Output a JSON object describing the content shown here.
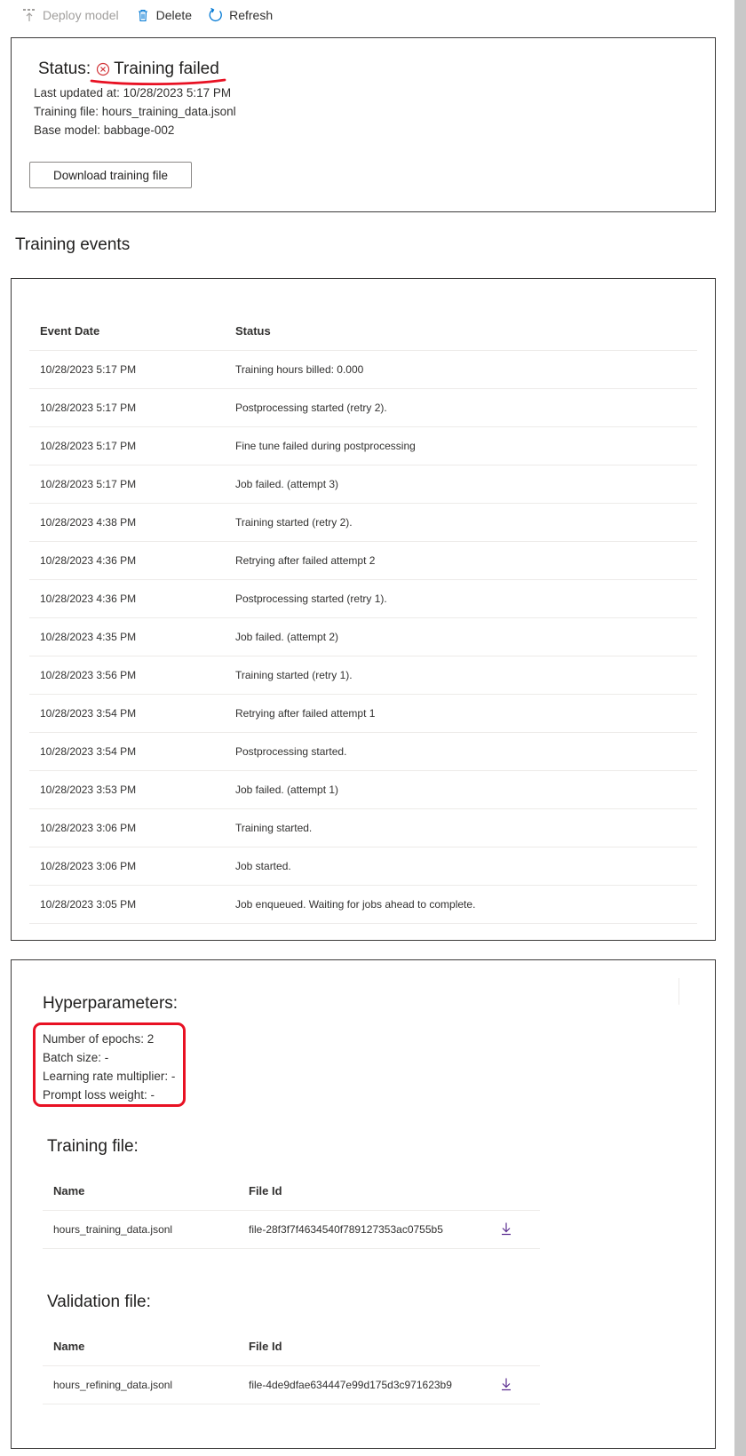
{
  "toolbar": {
    "deploy_label": "Deploy model",
    "delete_label": "Delete",
    "refresh_label": "Refresh"
  },
  "status": {
    "prefix": "Status:",
    "value": "Training failed",
    "last_updated": "Last updated at: 10/28/2023 5:17 PM",
    "training_file": "Training file: hours_training_data.jsonl",
    "base_model": "Base model: babbage-002",
    "download_label": "Download training file"
  },
  "events": {
    "heading": "Training events",
    "columns": [
      "Event Date",
      "Status"
    ],
    "rows": [
      [
        "10/28/2023 5:17 PM",
        "Training hours billed: 0.000"
      ],
      [
        "10/28/2023 5:17 PM",
        "Postprocessing started (retry 2)."
      ],
      [
        "10/28/2023 5:17 PM",
        "Fine tune failed during postprocessing"
      ],
      [
        "10/28/2023 5:17 PM",
        "Job failed. (attempt 3)"
      ],
      [
        "10/28/2023 4:38 PM",
        "Training started (retry 2)."
      ],
      [
        "10/28/2023 4:36 PM",
        "Retrying after failed attempt 2"
      ],
      [
        "10/28/2023 4:36 PM",
        "Postprocessing started (retry 1)."
      ],
      [
        "10/28/2023 4:35 PM",
        "Job failed. (attempt 2)"
      ],
      [
        "10/28/2023 3:56 PM",
        "Training started (retry 1)."
      ],
      [
        "10/28/2023 3:54 PM",
        "Retrying after failed attempt 1"
      ],
      [
        "10/28/2023 3:54 PM",
        "Postprocessing started."
      ],
      [
        "10/28/2023 3:53 PM",
        "Job failed. (attempt 1)"
      ],
      [
        "10/28/2023 3:06 PM",
        "Training started."
      ],
      [
        "10/28/2023 3:06 PM",
        "Job started."
      ],
      [
        "10/28/2023 3:05 PM",
        "Job enqueued. Waiting for jobs ahead to complete."
      ]
    ]
  },
  "hyper": {
    "title": "Hyperparameters:",
    "epochs": "Number of epochs: 2",
    "batch": "Batch size: -",
    "lr": "Learning rate multiplier: -",
    "prompt": "Prompt loss weight: -"
  },
  "training_file": {
    "title": "Training file:",
    "col_name": "Name",
    "col_id": "File Id",
    "name": "hours_training_data.jsonl",
    "id": "file-28f3f7f4634540f789127353ac0755b5"
  },
  "validation_file": {
    "title": "Validation file:",
    "col_name": "Name",
    "col_id": "File Id",
    "name": "hours_refining_data.jsonl",
    "id": "file-4de9dfae634447e99d175d3c971623b9"
  },
  "icons": {
    "deploy": "deploy-icon",
    "delete": "trash-icon",
    "refresh": "refresh-icon",
    "fail": "error-circle-icon",
    "download": "download-icon"
  },
  "colors": {
    "accent": "#0078d4",
    "error": "#d13438",
    "annotation": "#e81123",
    "download": "#5c2e91"
  }
}
